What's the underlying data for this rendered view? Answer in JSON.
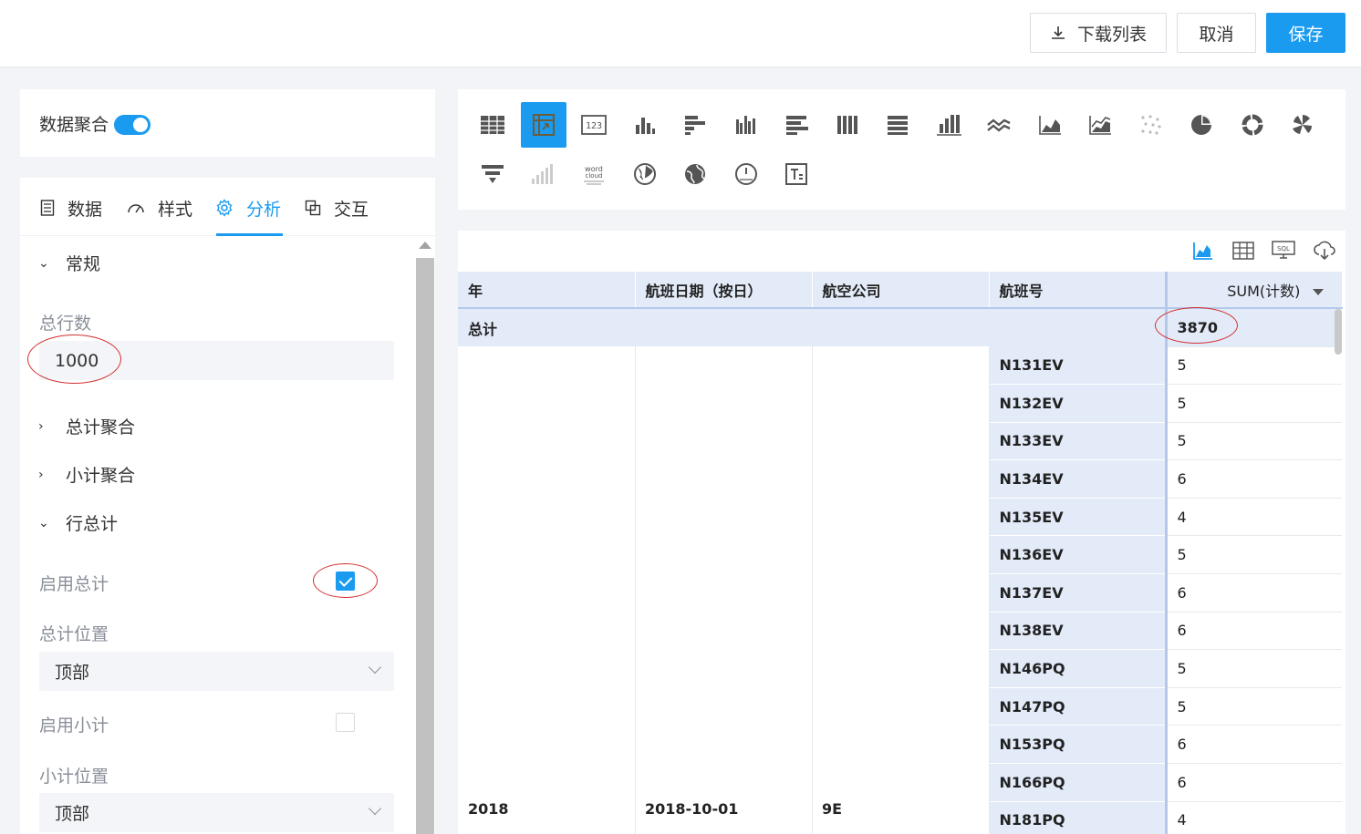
{
  "toolbar": {
    "download_label": "下载列表",
    "cancel_label": "取消",
    "save_label": "保存"
  },
  "aggregation": {
    "label": "数据聚合",
    "enabled": true
  },
  "tabs": [
    {
      "label": "数据",
      "icon": "document-icon"
    },
    {
      "label": "样式",
      "icon": "gauge-icon"
    },
    {
      "label": "分析",
      "icon": "gear-icon",
      "active": true
    },
    {
      "label": "交互",
      "icon": "overlap-squares-icon"
    }
  ],
  "analysis": {
    "general_label": "常规",
    "total_rows_label": "总行数",
    "total_rows_value": "1000",
    "grand_total_agg_label": "总计聚合",
    "subtotal_agg_label": "小计聚合",
    "row_total_label": "行总计",
    "enable_total_label": "启用总计",
    "enable_total_checked": true,
    "total_position_label": "总计位置",
    "total_position_value": "顶部",
    "enable_subtotal_label": "启用小计",
    "enable_subtotal_checked": false,
    "subtotal_position_label": "小计位置",
    "subtotal_position_value": "顶部"
  },
  "chart_types": {
    "row1": [
      "table-icon",
      "pivot-table-icon",
      "number-card-icon",
      "bar-chart-icon",
      "horizontal-bar-icon",
      "grouped-bar-icon",
      "stacked-horizontal-bar-icon",
      "stacked-column-icon",
      "percent-bar-icon",
      "waterfall-icon",
      "line-chart-icon",
      "area-chart-icon",
      "stacked-area-icon",
      "scatter-icon",
      "pie-chart-icon",
      "donut-chart-icon",
      "rose-chart-icon"
    ],
    "row2": [
      "funnel-icon",
      "rising-bar-icon",
      "word-cloud-icon",
      "globe-map-icon",
      "world-map-icon",
      "gauge-icon",
      "text-box-icon"
    ],
    "active": "pivot-table-icon",
    "accent": "#1a9bf0",
    "word_cloud_text": "word cloud"
  },
  "table_tools": [
    "area-chart-icon",
    "table-icon",
    "sql-icon",
    "cloud-download-icon"
  ],
  "table": {
    "headers": [
      "年",
      "航班日期（按日）",
      "航空公司",
      "航班号",
      "SUM(计数)"
    ],
    "total_label": "总计",
    "total_value": "3870",
    "year": "2018",
    "date": "2018-10-01",
    "airline": "9E",
    "rows": [
      {
        "flight": "N131EV",
        "value": "5"
      },
      {
        "flight": "N132EV",
        "value": "5"
      },
      {
        "flight": "N133EV",
        "value": "5"
      },
      {
        "flight": "N134EV",
        "value": "6"
      },
      {
        "flight": "N135EV",
        "value": "4"
      },
      {
        "flight": "N136EV",
        "value": "5"
      },
      {
        "flight": "N137EV",
        "value": "6"
      },
      {
        "flight": "N138EV",
        "value": "6"
      },
      {
        "flight": "N146PQ",
        "value": "5"
      },
      {
        "flight": "N147PQ",
        "value": "5"
      },
      {
        "flight": "N153PQ",
        "value": "6"
      },
      {
        "flight": "N166PQ",
        "value": "6"
      },
      {
        "flight": "N181PQ",
        "value": "4"
      }
    ]
  }
}
